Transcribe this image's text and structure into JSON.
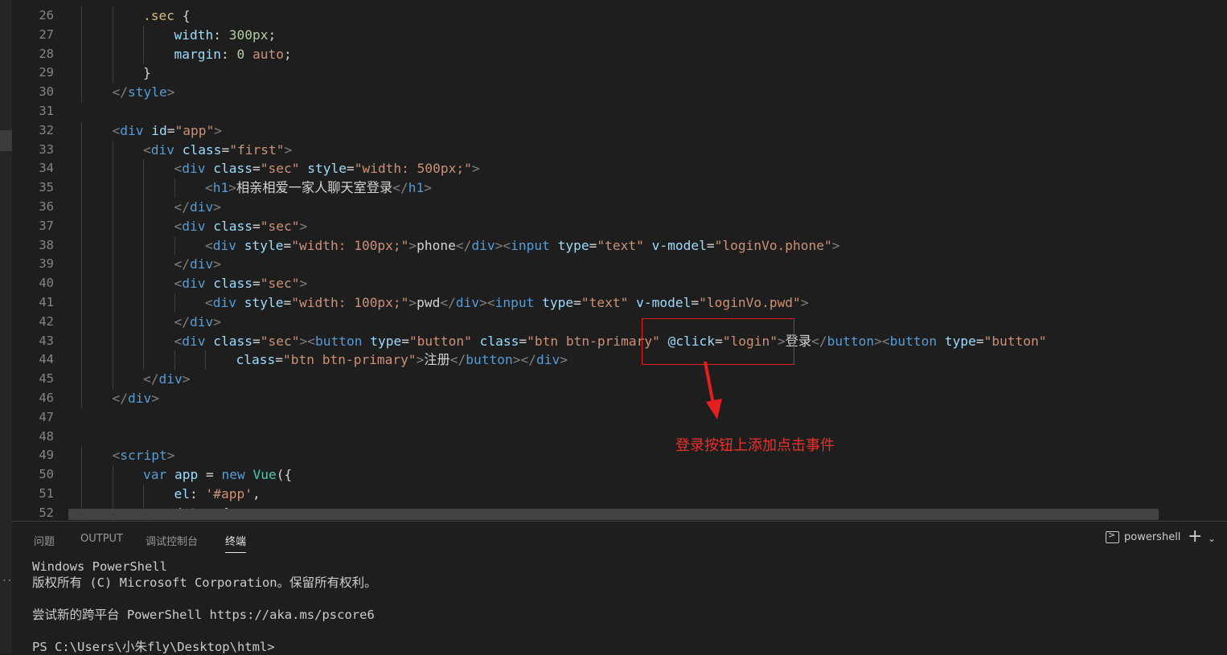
{
  "editor": {
    "lines": [
      {
        "n": "26",
        "indent": 2,
        "segs": [
          {
            "c": "sel",
            "t": ".sec"
          },
          {
            "c": "txt",
            "t": " {"
          }
        ]
      },
      {
        "n": "27",
        "indent": 3,
        "segs": [
          {
            "c": "prop",
            "t": "width"
          },
          {
            "c": "txt",
            "t": ": "
          },
          {
            "c": "num",
            "t": "300px"
          },
          {
            "c": "txt",
            "t": ";"
          }
        ]
      },
      {
        "n": "28",
        "indent": 3,
        "segs": [
          {
            "c": "prop",
            "t": "margin"
          },
          {
            "c": "txt",
            "t": ": "
          },
          {
            "c": "num",
            "t": "0"
          },
          {
            "c": "txt",
            "t": " "
          },
          {
            "c": "str",
            "t": "auto"
          },
          {
            "c": "txt",
            "t": ";"
          }
        ]
      },
      {
        "n": "29",
        "indent": 2,
        "segs": [
          {
            "c": "txt",
            "t": "}"
          }
        ]
      },
      {
        "n": "30",
        "indent": 1,
        "segs": [
          {
            "c": "t",
            "t": "</"
          },
          {
            "c": "tag",
            "t": "style"
          },
          {
            "c": "t",
            "t": ">"
          }
        ]
      },
      {
        "n": "31",
        "indent": 0,
        "segs": []
      },
      {
        "n": "32",
        "indent": 1,
        "segs": [
          {
            "c": "t",
            "t": "<"
          },
          {
            "c": "tag",
            "t": "div"
          },
          {
            "c": "txt",
            "t": " "
          },
          {
            "c": "attr",
            "t": "id"
          },
          {
            "c": "txt",
            "t": "="
          },
          {
            "c": "str",
            "t": "\"app\""
          },
          {
            "c": "t",
            "t": ">"
          }
        ]
      },
      {
        "n": "33",
        "indent": 2,
        "segs": [
          {
            "c": "t",
            "t": "<"
          },
          {
            "c": "tag",
            "t": "div"
          },
          {
            "c": "txt",
            "t": " "
          },
          {
            "c": "attr",
            "t": "class"
          },
          {
            "c": "txt",
            "t": "="
          },
          {
            "c": "str",
            "t": "\"first\""
          },
          {
            "c": "t",
            "t": ">"
          }
        ]
      },
      {
        "n": "34",
        "indent": 3,
        "segs": [
          {
            "c": "t",
            "t": "<"
          },
          {
            "c": "tag",
            "t": "div"
          },
          {
            "c": "txt",
            "t": " "
          },
          {
            "c": "attr",
            "t": "class"
          },
          {
            "c": "txt",
            "t": "="
          },
          {
            "c": "str",
            "t": "\"sec\""
          },
          {
            "c": "txt",
            "t": " "
          },
          {
            "c": "attr",
            "t": "style"
          },
          {
            "c": "txt",
            "t": "="
          },
          {
            "c": "str",
            "t": "\"width: 500px;\""
          },
          {
            "c": "t",
            "t": ">"
          }
        ]
      },
      {
        "n": "35",
        "indent": 4,
        "segs": [
          {
            "c": "t",
            "t": "<"
          },
          {
            "c": "tag",
            "t": "h1"
          },
          {
            "c": "t",
            "t": ">"
          },
          {
            "c": "txt",
            "t": "相亲相爱一家人聊天室登录"
          },
          {
            "c": "t",
            "t": "</"
          },
          {
            "c": "tag",
            "t": "h1"
          },
          {
            "c": "t",
            "t": ">"
          }
        ]
      },
      {
        "n": "36",
        "indent": 3,
        "segs": [
          {
            "c": "t",
            "t": "</"
          },
          {
            "c": "tag",
            "t": "div"
          },
          {
            "c": "t",
            "t": ">"
          }
        ]
      },
      {
        "n": "37",
        "indent": 3,
        "segs": [
          {
            "c": "t",
            "t": "<"
          },
          {
            "c": "tag",
            "t": "div"
          },
          {
            "c": "txt",
            "t": " "
          },
          {
            "c": "attr",
            "t": "class"
          },
          {
            "c": "txt",
            "t": "="
          },
          {
            "c": "str",
            "t": "\"sec\""
          },
          {
            "c": "t",
            "t": ">"
          }
        ]
      },
      {
        "n": "38",
        "indent": 4,
        "segs": [
          {
            "c": "t",
            "t": "<"
          },
          {
            "c": "tag",
            "t": "div"
          },
          {
            "c": "txt",
            "t": " "
          },
          {
            "c": "attr",
            "t": "style"
          },
          {
            "c": "txt",
            "t": "="
          },
          {
            "c": "str",
            "t": "\"width: 100px;\""
          },
          {
            "c": "t",
            "t": ">"
          },
          {
            "c": "txt",
            "t": "phone"
          },
          {
            "c": "t",
            "t": "</"
          },
          {
            "c": "tag",
            "t": "div"
          },
          {
            "c": "t",
            "t": "><"
          },
          {
            "c": "tag",
            "t": "input"
          },
          {
            "c": "txt",
            "t": " "
          },
          {
            "c": "attr",
            "t": "type"
          },
          {
            "c": "txt",
            "t": "="
          },
          {
            "c": "str",
            "t": "\"text\""
          },
          {
            "c": "txt",
            "t": " "
          },
          {
            "c": "attr",
            "t": "v-model"
          },
          {
            "c": "txt",
            "t": "="
          },
          {
            "c": "str",
            "t": "\"loginVo.phone\""
          },
          {
            "c": "t",
            "t": ">"
          }
        ]
      },
      {
        "n": "39",
        "indent": 3,
        "segs": [
          {
            "c": "t",
            "t": "</"
          },
          {
            "c": "tag",
            "t": "div"
          },
          {
            "c": "t",
            "t": ">"
          }
        ]
      },
      {
        "n": "40",
        "indent": 3,
        "segs": [
          {
            "c": "t",
            "t": "<"
          },
          {
            "c": "tag",
            "t": "div"
          },
          {
            "c": "txt",
            "t": " "
          },
          {
            "c": "attr",
            "t": "class"
          },
          {
            "c": "txt",
            "t": "="
          },
          {
            "c": "str",
            "t": "\"sec\""
          },
          {
            "c": "t",
            "t": ">"
          }
        ]
      },
      {
        "n": "41",
        "indent": 4,
        "segs": [
          {
            "c": "t",
            "t": "<"
          },
          {
            "c": "tag",
            "t": "div"
          },
          {
            "c": "txt",
            "t": " "
          },
          {
            "c": "attr",
            "t": "style"
          },
          {
            "c": "txt",
            "t": "="
          },
          {
            "c": "str",
            "t": "\"width: 100px;\""
          },
          {
            "c": "t",
            "t": ">"
          },
          {
            "c": "txt",
            "t": "pwd"
          },
          {
            "c": "t",
            "t": "</"
          },
          {
            "c": "tag",
            "t": "div"
          },
          {
            "c": "t",
            "t": "><"
          },
          {
            "c": "tag",
            "t": "input"
          },
          {
            "c": "txt",
            "t": " "
          },
          {
            "c": "attr",
            "t": "type"
          },
          {
            "c": "txt",
            "t": "="
          },
          {
            "c": "str",
            "t": "\"text\""
          },
          {
            "c": "txt",
            "t": " "
          },
          {
            "c": "attr",
            "t": "v-model"
          },
          {
            "c": "txt",
            "t": "="
          },
          {
            "c": "str",
            "t": "\"loginVo.pwd\""
          },
          {
            "c": "t",
            "t": ">"
          }
        ]
      },
      {
        "n": "42",
        "indent": 3,
        "segs": [
          {
            "c": "t",
            "t": "</"
          },
          {
            "c": "tag",
            "t": "div"
          },
          {
            "c": "t",
            "t": ">"
          }
        ]
      },
      {
        "n": "43",
        "indent": 3,
        "segs": [
          {
            "c": "t",
            "t": "<"
          },
          {
            "c": "tag",
            "t": "div"
          },
          {
            "c": "txt",
            "t": " "
          },
          {
            "c": "attr",
            "t": "class"
          },
          {
            "c": "txt",
            "t": "="
          },
          {
            "c": "str",
            "t": "\"sec\""
          },
          {
            "c": "t",
            "t": "><"
          },
          {
            "c": "tag",
            "t": "button"
          },
          {
            "c": "txt",
            "t": " "
          },
          {
            "c": "attr",
            "t": "type"
          },
          {
            "c": "txt",
            "t": "="
          },
          {
            "c": "str",
            "t": "\"button\""
          },
          {
            "c": "txt",
            "t": " "
          },
          {
            "c": "attr",
            "t": "class"
          },
          {
            "c": "txt",
            "t": "="
          },
          {
            "c": "str",
            "t": "\"btn btn-primary\""
          },
          {
            "c": "txt",
            "t": " "
          },
          {
            "c": "attr",
            "t": "@click"
          },
          {
            "c": "txt",
            "t": "="
          },
          {
            "c": "str",
            "t": "\"login\""
          },
          {
            "c": "t",
            "t": ">"
          },
          {
            "c": "txt",
            "t": "登录"
          },
          {
            "c": "t",
            "t": "</"
          },
          {
            "c": "tag",
            "t": "button"
          },
          {
            "c": "t",
            "t": "><"
          },
          {
            "c": "tag",
            "t": "button"
          },
          {
            "c": "txt",
            "t": " "
          },
          {
            "c": "attr",
            "t": "type"
          },
          {
            "c": "txt",
            "t": "="
          },
          {
            "c": "str",
            "t": "\"button\""
          }
        ]
      },
      {
        "n": "44",
        "indent": 5,
        "segs": [
          {
            "c": "attr",
            "t": "class"
          },
          {
            "c": "txt",
            "t": "="
          },
          {
            "c": "str",
            "t": "\"btn btn-primary\""
          },
          {
            "c": "t",
            "t": ">"
          },
          {
            "c": "txt",
            "t": "注册"
          },
          {
            "c": "t",
            "t": "</"
          },
          {
            "c": "tag",
            "t": "button"
          },
          {
            "c": "t",
            "t": "></"
          },
          {
            "c": "tag",
            "t": "div"
          },
          {
            "c": "t",
            "t": ">"
          }
        ]
      },
      {
        "n": "45",
        "indent": 2,
        "segs": [
          {
            "c": "t",
            "t": "</"
          },
          {
            "c": "tag",
            "t": "div"
          },
          {
            "c": "t",
            "t": ">"
          }
        ]
      },
      {
        "n": "46",
        "indent": 1,
        "segs": [
          {
            "c": "t",
            "t": "</"
          },
          {
            "c": "tag",
            "t": "div"
          },
          {
            "c": "t",
            "t": ">"
          }
        ]
      },
      {
        "n": "47",
        "indent": 0,
        "segs": []
      },
      {
        "n": "48",
        "indent": 0,
        "segs": []
      },
      {
        "n": "49",
        "indent": 1,
        "segs": [
          {
            "c": "t",
            "t": "<"
          },
          {
            "c": "tag",
            "t": "script"
          },
          {
            "c": "t",
            "t": ">"
          }
        ]
      },
      {
        "n": "50",
        "indent": 2,
        "segs": [
          {
            "c": "kw",
            "t": "var"
          },
          {
            "c": "txt",
            "t": " "
          },
          {
            "c": "attr",
            "t": "app"
          },
          {
            "c": "txt",
            "t": " = "
          },
          {
            "c": "kw",
            "t": "new"
          },
          {
            "c": "txt",
            "t": " "
          },
          {
            "c": "cls",
            "t": "Vue"
          },
          {
            "c": "txt",
            "t": "({"
          }
        ]
      },
      {
        "n": "51",
        "indent": 3,
        "segs": [
          {
            "c": "attr",
            "t": "el"
          },
          {
            "c": "txt",
            "t": ": "
          },
          {
            "c": "str",
            "t": "'#app'"
          },
          {
            "c": "txt",
            "t": ","
          }
        ]
      },
      {
        "n": "52",
        "indent": 3,
        "segs": [
          {
            "c": "attr",
            "t": "data"
          },
          {
            "c": "txt",
            "t": ": {"
          }
        ]
      }
    ]
  },
  "annotation": {
    "text": "登录按钮上添加点击事件",
    "color": "#e8312a"
  },
  "panel": {
    "tabs": [
      "问题",
      "OUTPUT",
      "调试控制台",
      "终端"
    ],
    "active_tab": "终端",
    "terminal_name": "powershell",
    "terminal_lines": [
      "Windows PowerShell",
      "版权所有 (C) Microsoft Corporation。保留所有权利。",
      "",
      "尝试新的跨平台 PowerShell https://aka.ms/pscore6",
      "",
      "PS C:\\Users\\小朱fly\\Desktop\\html>"
    ]
  }
}
